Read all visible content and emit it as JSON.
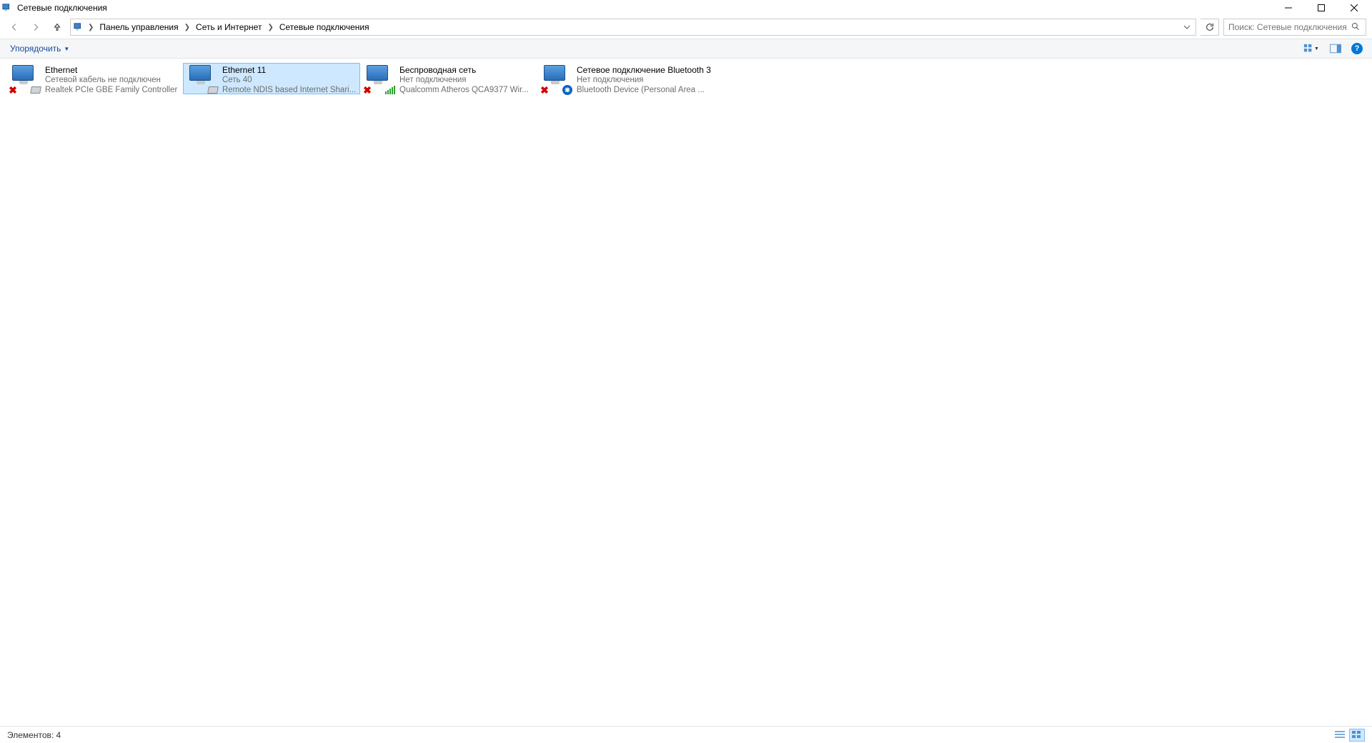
{
  "window": {
    "title": "Сетевые подключения"
  },
  "breadcrumb": {
    "items": [
      "Панель управления",
      "Сеть и Интернет",
      "Сетевые подключения"
    ]
  },
  "search": {
    "placeholder": "Поиск: Сетевые подключения"
  },
  "commandbar": {
    "organize": "Упорядочить"
  },
  "adapters": [
    {
      "name": "Ethernet",
      "status": "Сетевой кабель не подключен",
      "device": "Realtek PCIe GBE Family Controller",
      "overlay_left": "x",
      "overlay_right": "nic",
      "selected": false
    },
    {
      "name": "Ethernet 11",
      "status": "Сеть 40",
      "device": "Remote NDIS based Internet Shari...",
      "overlay_left": "none",
      "overlay_right": "nic",
      "selected": true
    },
    {
      "name": "Беспроводная сеть",
      "status": "Нет подключения",
      "device": "Qualcomm Atheros QCA9377 Wir...",
      "overlay_left": "x",
      "overlay_right": "bars",
      "selected": false
    },
    {
      "name": "Сетевое подключение Bluetooth 3",
      "status": "Нет подключения",
      "device": "Bluetooth Device (Personal Area ...",
      "overlay_left": "x",
      "overlay_right": "bt",
      "selected": false
    }
  ],
  "statusbar": {
    "count_label": "Элементов:",
    "count": "4"
  }
}
